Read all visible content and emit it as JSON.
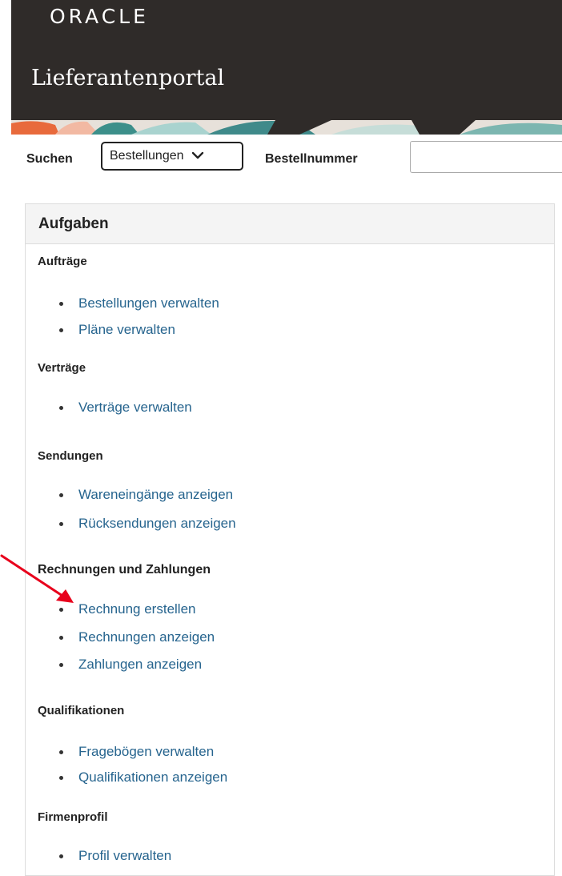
{
  "header": {
    "logo": "ORACLE",
    "portal_title": "Lieferantenportal"
  },
  "search": {
    "label": "Suchen",
    "selected_option": "Bestellungen",
    "field_label": "Bestellnummer",
    "field_value": ""
  },
  "tasks": {
    "title": "Aufgaben",
    "sections": [
      {
        "title": "Aufträge",
        "items": [
          "Bestellungen verwalten",
          "Pläne verwalten"
        ]
      },
      {
        "title": "Verträge",
        "items": [
          "Verträge verwalten"
        ]
      },
      {
        "title": "Sendungen",
        "items": [
          "Wareneingänge anzeigen",
          "Rücksendungen anzeigen"
        ]
      },
      {
        "title": "Rechnungen und Zahlungen",
        "items": [
          "Rechnung erstellen",
          "Rechnungen anzeigen",
          "Zahlungen anzeigen"
        ]
      },
      {
        "title": "Qualifikationen",
        "items": [
          "Fragebögen verwalten",
          "Qualifikationen anzeigen"
        ]
      },
      {
        "title": "Firmenprofil",
        "items": [
          "Profil verwalten"
        ]
      }
    ]
  },
  "annotation": {
    "arrow_color": "#e8001c",
    "points_to": "Rechnung erstellen"
  },
  "colors": {
    "header_bg": "#2f2b29",
    "link": "#26648e"
  }
}
